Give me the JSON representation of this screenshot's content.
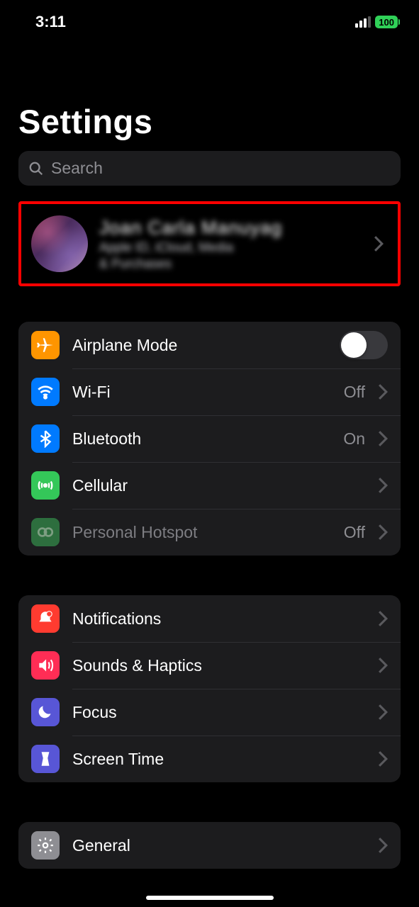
{
  "status": {
    "time": "3:11",
    "battery": "100"
  },
  "header": {
    "title": "Settings",
    "search_placeholder": "Search"
  },
  "profile": {
    "name": "Joan Carla Manuyag",
    "subtitle_line1": "Apple ID, iCloud, Media",
    "subtitle_line2": "& Purchases"
  },
  "groups": [
    {
      "rows": [
        {
          "icon": "airplane-icon",
          "icon_color": "bg-orange",
          "label": "Airplane Mode",
          "control": "toggle",
          "toggle_on": false
        },
        {
          "icon": "wifi-icon",
          "icon_color": "bg-blue",
          "label": "Wi-Fi",
          "value": "Off",
          "control": "chevron"
        },
        {
          "icon": "bluetooth-icon",
          "icon_color": "bg-blue",
          "label": "Bluetooth",
          "value": "On",
          "control": "chevron"
        },
        {
          "icon": "cellular-icon",
          "icon_color": "bg-green",
          "label": "Cellular",
          "control": "chevron"
        },
        {
          "icon": "hotspot-icon",
          "icon_color": "bg-darkgreen",
          "label": "Personal Hotspot",
          "value": "Off",
          "control": "chevron",
          "dimmed": true
        }
      ]
    },
    {
      "rows": [
        {
          "icon": "notifications-icon",
          "icon_color": "bg-red",
          "label": "Notifications",
          "control": "chevron"
        },
        {
          "icon": "sounds-icon",
          "icon_color": "bg-pink",
          "label": "Sounds & Haptics",
          "control": "chevron"
        },
        {
          "icon": "focus-icon",
          "icon_color": "bg-indigo",
          "label": "Focus",
          "control": "chevron"
        },
        {
          "icon": "screentime-icon",
          "icon_color": "bg-indigo",
          "label": "Screen Time",
          "control": "chevron"
        }
      ]
    },
    {
      "rows": [
        {
          "icon": "general-icon",
          "icon_color": "bg-gray",
          "label": "General",
          "control": "chevron"
        }
      ]
    }
  ]
}
